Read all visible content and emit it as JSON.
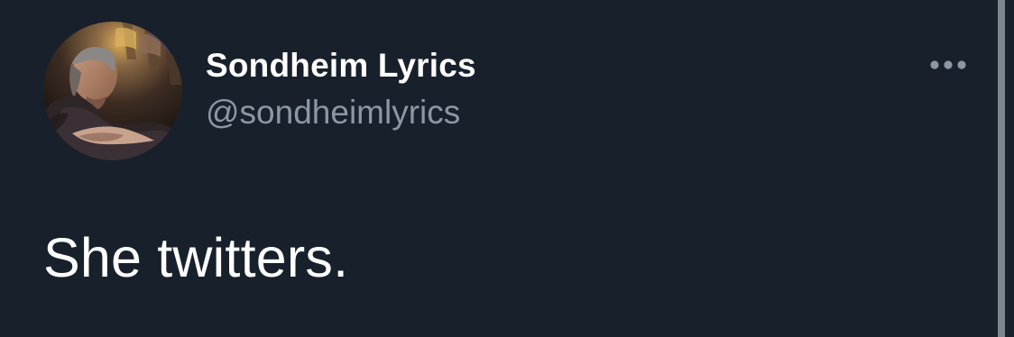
{
  "tweet": {
    "author": {
      "display_name": "Sondheim Lyrics",
      "handle": "@sondheimlyrics",
      "avatar_icon": "profile-photo"
    },
    "text": "She twitters.",
    "more_icon": "more-horizontal-icon"
  },
  "colors": {
    "background": "#18202b",
    "primary_text": "#ffffff",
    "secondary_text": "#8c97a4",
    "scrollbar": "#7d858e"
  }
}
